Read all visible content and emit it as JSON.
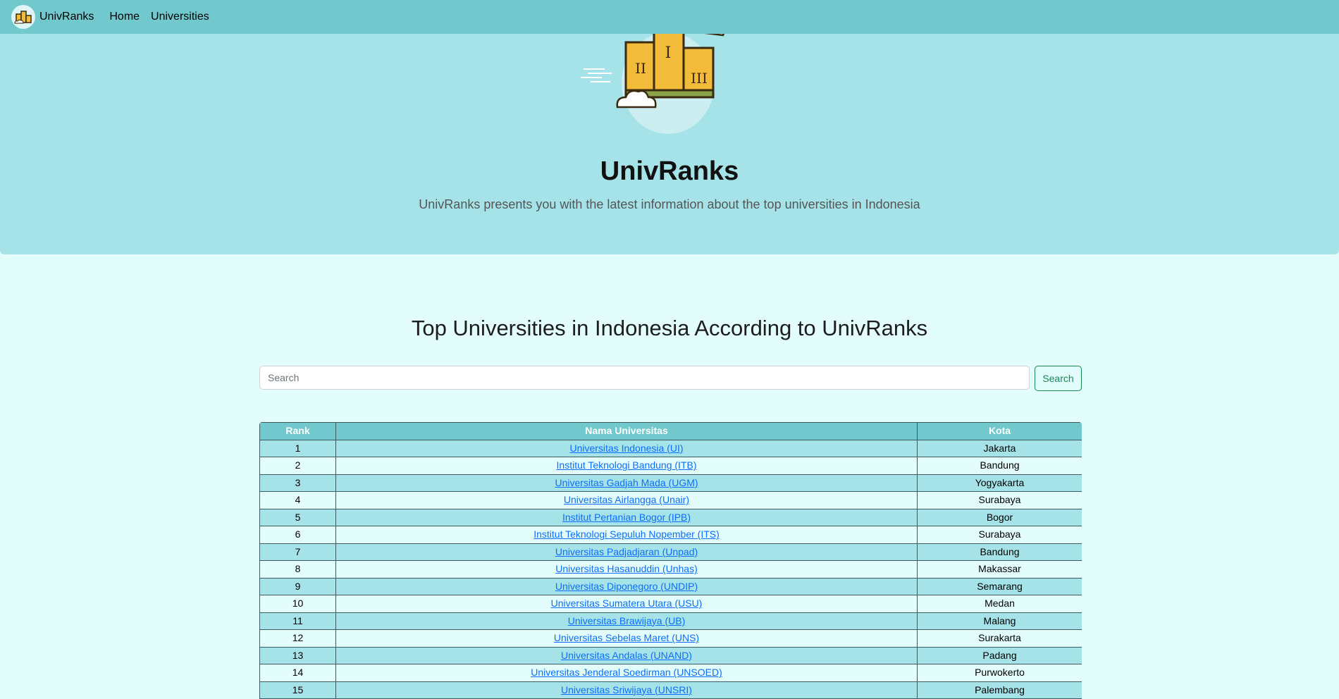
{
  "navbar": {
    "brand": "UnivRanks",
    "links": [
      "Home",
      "Universities"
    ]
  },
  "hero": {
    "title": "UnivRanks",
    "subtitle": "UnivRanks presents you with the latest information about the top universities in Indonesia",
    "podium_numerals": [
      "I",
      "II",
      "III"
    ]
  },
  "section": {
    "title": "Top Universities in Indonesia According to UnivRanks"
  },
  "search": {
    "placeholder": "Search",
    "value": "",
    "button": "Search"
  },
  "table": {
    "headers": [
      "Rank",
      "Nama Universitas",
      "Kota"
    ],
    "rows": [
      {
        "rank": "1",
        "name": "Universitas Indonesia (UI)",
        "city": "Jakarta"
      },
      {
        "rank": "2",
        "name": "Institut Teknologi Bandung (ITB)",
        "city": "Bandung"
      },
      {
        "rank": "3",
        "name": "Universitas Gadjah Mada (UGM)",
        "city": "Yogyakarta"
      },
      {
        "rank": "4",
        "name": "Universitas Airlangga (Unair)",
        "city": "Surabaya"
      },
      {
        "rank": "5",
        "name": "Institut Pertanian Bogor (IPB)",
        "city": "Bogor"
      },
      {
        "rank": "6",
        "name": "Institut Teknologi Sepuluh Nopember (ITS)",
        "city": "Surabaya"
      },
      {
        "rank": "7",
        "name": "Universitas Padjadjaran (Unpad)",
        "city": "Bandung"
      },
      {
        "rank": "8",
        "name": "Universitas Hasanuddin (Unhas)",
        "city": "Makassar"
      },
      {
        "rank": "9",
        "name": "Universitas Diponegoro (UNDIP)",
        "city": "Semarang"
      },
      {
        "rank": "10",
        "name": "Universitas Sumatera Utara (USU)",
        "city": "Medan"
      },
      {
        "rank": "11",
        "name": "Universitas Brawijaya (UB)",
        "city": "Malang"
      },
      {
        "rank": "12",
        "name": "Universitas Sebelas Maret (UNS)",
        "city": "Surakarta"
      },
      {
        "rank": "13",
        "name": "Universitas Andalas (UNAND)",
        "city": "Padang"
      },
      {
        "rank": "14",
        "name": "Universitas Jenderal Soedirman (UNSOED)",
        "city": "Purwokerto"
      },
      {
        "rank": "15",
        "name": "Universitas Sriwijaya (UNSRI)",
        "city": "Palembang"
      }
    ]
  },
  "colors": {
    "navbar": "#71c9ce",
    "hero": "#a6e3e9",
    "page": "#e3fdfd",
    "link": "#0d6efd",
    "search_button": "#198754"
  },
  "icons": {
    "brand_logo": "podium-logo-icon",
    "hero_image": "podium-illustration"
  }
}
